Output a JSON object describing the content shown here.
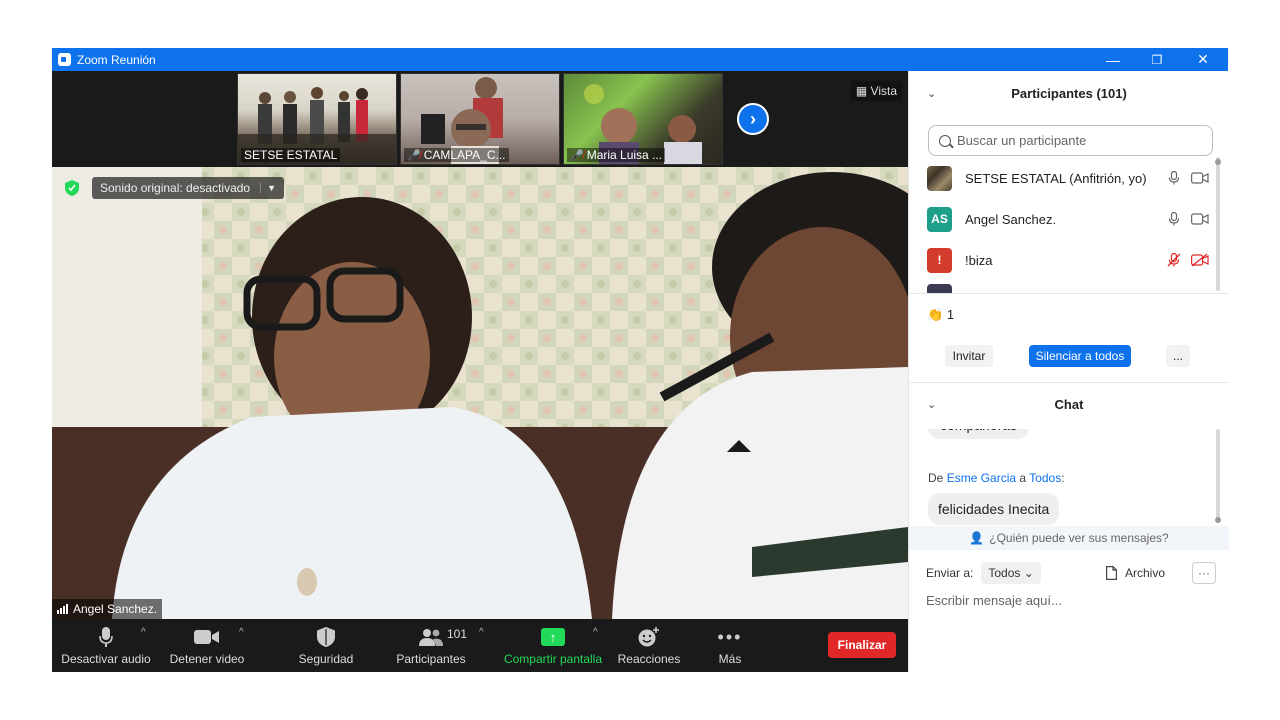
{
  "window": {
    "title": "Zoom Reunión",
    "minimize": "—",
    "restore": "❐",
    "close": "✕"
  },
  "gallery": {
    "thumbnails": [
      {
        "name": "SETSE ESTATAL",
        "muted": false
      },
      {
        "name": "CAMLAPA_C...",
        "muted": true
      },
      {
        "name": "Maria Luisa ...",
        "muted": true
      }
    ],
    "next_glyph": "›",
    "vista_label": "Vista"
  },
  "main_video": {
    "sound_label": "Sonido original: desactivado",
    "speaker_name": "Angel Sanchez."
  },
  "toolbar": {
    "audio": "Desactivar audio",
    "video": "Detener video",
    "security": "Seguridad",
    "participants": "Participantes",
    "participants_count": "101",
    "share": "Compartir pantalla",
    "reactions": "Reacciones",
    "more": "Más",
    "end": "Finalizar"
  },
  "participants_panel": {
    "header": "Participantes (101)",
    "search_placeholder": "Buscar un participante",
    "rows": [
      {
        "name": "SETSE ESTATAL (Anfitrión, yo)",
        "avatar": "",
        "avatar_color": "#6b5a3e",
        "muted": false
      },
      {
        "name": "Angel Sanchez.",
        "avatar": "AS",
        "avatar_color": "#1e9f8a",
        "muted": false
      },
      {
        "name": "!biza",
        "avatar": "!",
        "avatar_color": "#d33b2c",
        "muted": true
      }
    ],
    "reaction_count": "1",
    "invite": "Invitar",
    "mute_all": "Silenciar a todos",
    "more": "..."
  },
  "chat": {
    "header": "Chat",
    "partial_message": "compañeras",
    "from_prefix": "De ",
    "from_name": "Esme Garcia",
    "from_mid": " a ",
    "to_name": "Todos",
    "from_suffix": ":",
    "message": "felicidades Inecita",
    "who_can_see": "¿Quién puede ver sus mensajes?",
    "send_to_label": "Enviar a:",
    "send_to_value": "Todos",
    "file_label": "Archivo",
    "more": "···",
    "input_placeholder": "Escribir mensaje aquí..."
  },
  "colors": {
    "zoom_blue": "#0e72ed",
    "end_red": "#e02828",
    "share_green": "#23d959"
  }
}
